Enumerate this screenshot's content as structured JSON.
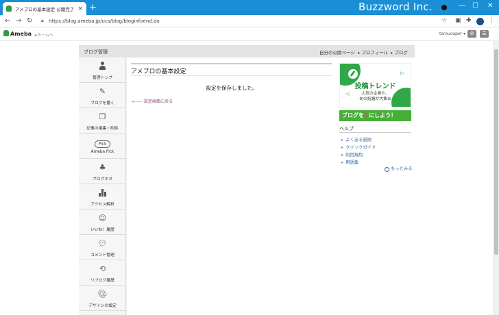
{
  "browser": {
    "tab_title": "アメブロの基本設定 公開完了 | Am",
    "tab_close": "×",
    "new_tab": "+",
    "brand": "Buzzword Inc.",
    "url": "https://blog.ameba.jp/ucs/blog/bloginfoend.do",
    "win_min": "—",
    "win_max": "☐",
    "win_close": "✕"
  },
  "ameba_header": {
    "logo": "Ameba",
    "home_link": "▸ホームへ",
    "user_name": "tarouoaper ▾"
  },
  "blog_header": {
    "title": "ブログ管理",
    "links": [
      "自分の公開ページ",
      "▸ プロフィール",
      "▸ ブログ"
    ]
  },
  "sidebar": {
    "items": [
      {
        "label": "管理トップ",
        "icon": "person-icon"
      },
      {
        "label": "ブログを書く",
        "icon": "pen-icon"
      },
      {
        "label": "記事の編集・削除",
        "icon": "copy-icon"
      },
      {
        "label": "Ameba Pick",
        "icon": "pick-badge",
        "badge": "Pick"
      },
      {
        "label": "ブログネタ",
        "icon": "sprout-icon"
      },
      {
        "label": "アクセス解析",
        "icon": "bar-chart-icon"
      },
      {
        "label": "いいね！履歴",
        "icon": "smile-icon"
      },
      {
        "label": "コメント管理",
        "icon": "comment-icon"
      },
      {
        "label": "リブログ履歴",
        "icon": "reblog-icon"
      },
      {
        "label": "デザインの設定",
        "icon": "palette-icon"
      }
    ]
  },
  "main": {
    "title": "アメブロの基本設定",
    "message": "設定を保存しました。",
    "back_link": "設定画面に戻る"
  },
  "right": {
    "banner1": {
      "title": "投稿トレンド",
      "sub1": "人気の企画や、",
      "sub2": "旬の話題が大集合"
    },
    "banner2": {
      "pre": "ブログを",
      "mid": "★",
      "post": "にしよう！"
    },
    "help_title": "ヘルプ",
    "help_items": [
      "よくある質問",
      "クイックガイド",
      "利用規約",
      "用語集"
    ],
    "more": "もっとみる"
  },
  "colors": {
    "chrome_blue": "#1a8fd5",
    "ameba_green": "#2e9e3e",
    "link_blue": "#3a66a8"
  }
}
